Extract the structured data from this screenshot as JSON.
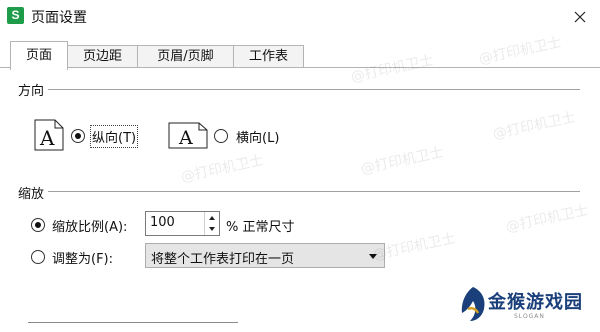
{
  "window": {
    "app_icon_letter": "S",
    "title": "页面设置",
    "close_glyph": "✕"
  },
  "tabs": [
    {
      "label": "页面",
      "active": true
    },
    {
      "label": "页边距",
      "active": false
    },
    {
      "label": "页眉/页脚",
      "active": false
    },
    {
      "label": "工作表",
      "active": false
    }
  ],
  "orientation": {
    "section_label": "方向",
    "portrait": {
      "label": "纵向(T)",
      "selected": true,
      "icon": "document-portrait-icon",
      "icon_letter": "A"
    },
    "landscape": {
      "label": "横向(L)",
      "selected": false,
      "icon": "document-landscape-icon",
      "icon_letter": "A"
    }
  },
  "scaling": {
    "section_label": "缩放",
    "scale": {
      "label": "缩放比例(A):",
      "selected": true,
      "value": "100",
      "suffix": "% 正常尺寸"
    },
    "fit": {
      "label": "调整为(F):",
      "selected": false,
      "dropdown_value": "将整个工作表打印在一页"
    }
  },
  "watermark_text": "@打印机卫士",
  "brand": {
    "name": "金猴游戏园",
    "sub": "SLOGAN",
    "accent": "#1a3f7a"
  }
}
